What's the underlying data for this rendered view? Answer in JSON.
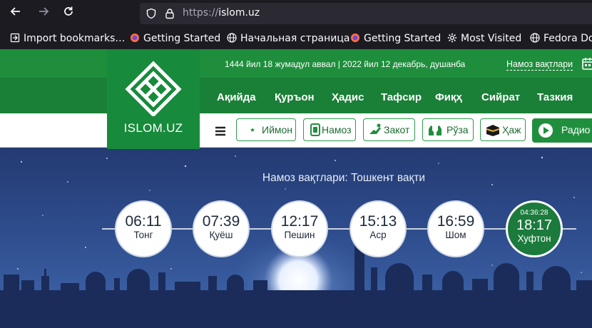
{
  "browser": {
    "url_scheme": "https://",
    "url_host": "islom.uz",
    "bookmarks": [
      {
        "label": "Import bookmarks…",
        "icon": "import-icon"
      },
      {
        "label": "Getting Started",
        "icon": "firefox-icon"
      },
      {
        "label": "Начальная страница",
        "icon": "globe-icon"
      },
      {
        "label": "Getting Started",
        "icon": "firefox-icon"
      },
      {
        "label": "Most Visited",
        "icon": "gear-icon"
      },
      {
        "label": "Fedora Do",
        "icon": "globe-icon"
      }
    ]
  },
  "site": {
    "logo_text": "ISLOM.UZ",
    "date_line": "1444 йил 18 жумадул аввал | 2022 йил 12 декабрь, душанба",
    "prayer_times_link": "Намоз вақтлари",
    "menu": [
      "Ақийда",
      "Қуръон",
      "Ҳадис",
      "Тафсир",
      "Фиқҳ",
      "Сийрат",
      "Тазкия"
    ],
    "sections": [
      {
        "label": "Иймон",
        "icon": "crescent-star-icon"
      },
      {
        "label": "Намоз",
        "icon": "prayer-mat-icon"
      },
      {
        "label": "Закот",
        "icon": "giving-hand-icon"
      },
      {
        "label": "Рўза",
        "icon": "praying-hands-icon"
      },
      {
        "label": "Ҳаж",
        "icon": "kaaba-icon"
      }
    ],
    "radio_label": "Радио"
  },
  "hero": {
    "title_prefix": "Намоз вақтлари:",
    "title_city": "Тошкент вақти",
    "prayers": [
      {
        "time": "06:11",
        "name": "Тонг"
      },
      {
        "time": "07:39",
        "name": "Қуёш"
      },
      {
        "time": "12:17",
        "name": "Пешин"
      },
      {
        "time": "15:13",
        "name": "Аср"
      },
      {
        "time": "16:59",
        "name": "Шом"
      },
      {
        "time": "18:17",
        "name": "Хуфтон",
        "countdown": "04:36:28",
        "active": true
      }
    ]
  },
  "colors": {
    "brand_green": "#1f8f3e",
    "active_green": "#1b7a3c",
    "sky_blue": "#2e4c8c"
  }
}
